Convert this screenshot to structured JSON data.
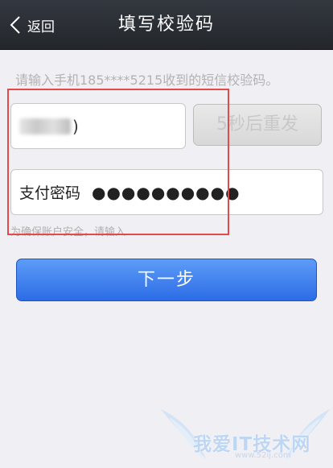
{
  "navbar": {
    "back_label": "返回",
    "title": "填写校验码"
  },
  "hint": {
    "text": "请输入手机185****5215收到的短信校验码。"
  },
  "code_field": {
    "visible_tail": ")"
  },
  "resend_button": {
    "label": "5秒后重发"
  },
  "password_field": {
    "label": "支付密码",
    "masked_value": "●●●●●●●●●●"
  },
  "security_hint": {
    "text": "为确保账户安全，请输入"
  },
  "next_button": {
    "label": "下一步"
  },
  "watermark": {
    "text": "我爱IT技术网",
    "url": "www.52ij.com"
  },
  "colors": {
    "navbar": "#2b2f35",
    "background": "#efeff4",
    "primary_button": "#3b7cf0",
    "annotation": "#e34b4b"
  }
}
